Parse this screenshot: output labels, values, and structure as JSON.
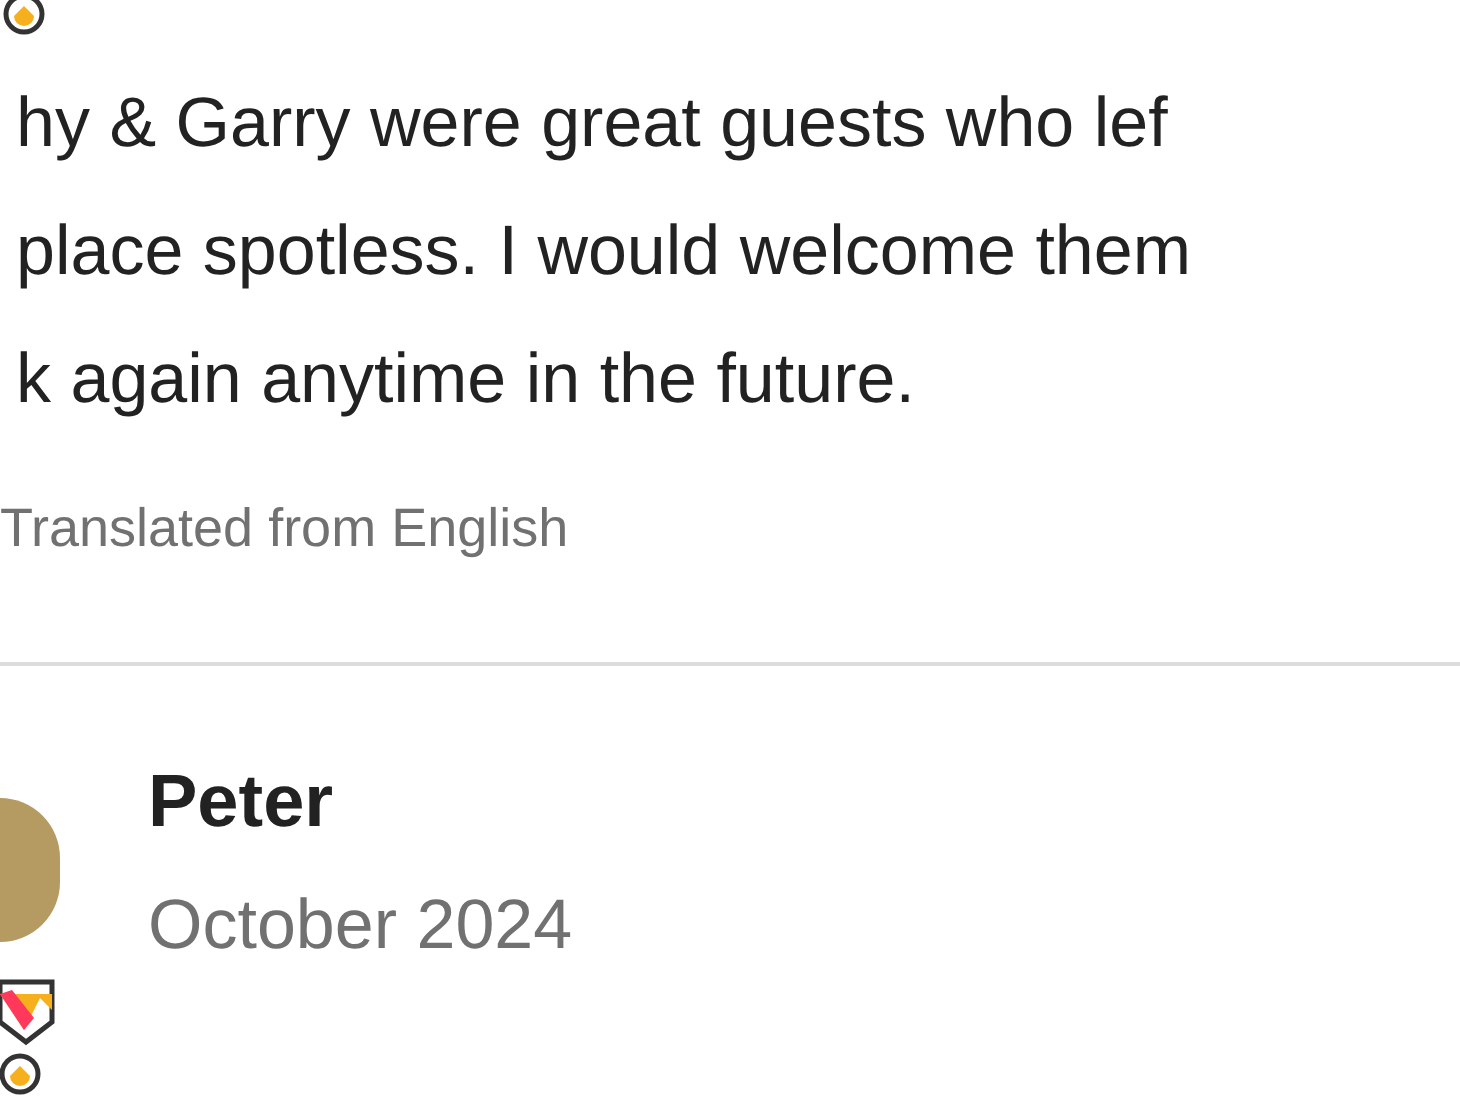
{
  "review_top": {
    "text_lines": [
      "hy & Garry were great guests who lef",
      "place spotless. I would welcome them",
      "k again anytime in the future."
    ],
    "translation_note": "Translated from English"
  },
  "review_next": {
    "reviewer": "Peter",
    "date": "October 2024"
  }
}
